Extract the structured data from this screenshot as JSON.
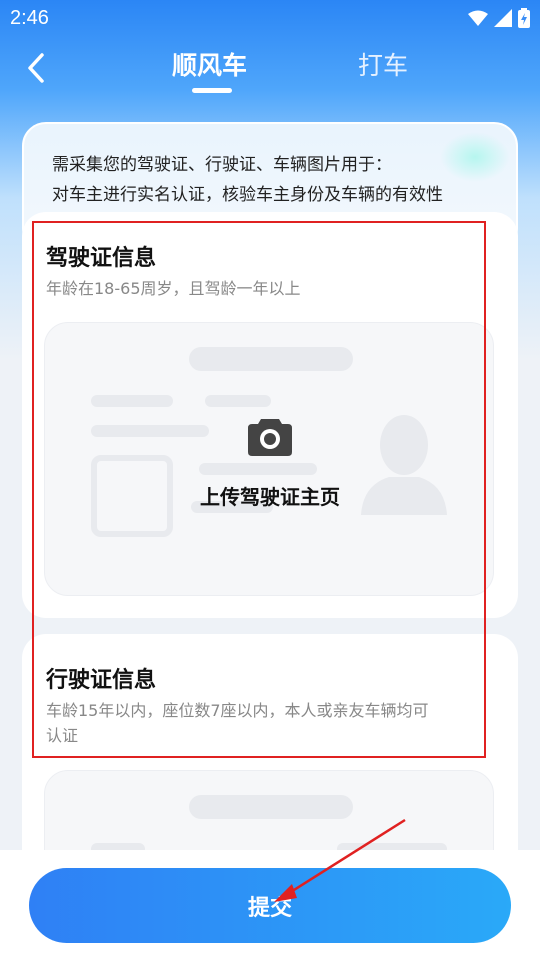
{
  "status_bar": {
    "time": "2:46"
  },
  "nav": {
    "tabs": [
      {
        "label": "顺风车",
        "active": true
      },
      {
        "label": "打车",
        "active": false
      }
    ]
  },
  "notice": {
    "line1": "需采集您的驾驶证、行驶证、车辆图片用于：",
    "line2": "对车主进行实名认证，核验车主身份及车辆的有效性"
  },
  "driver_license": {
    "title": "驾驶证信息",
    "subtitle": "年龄在18-65周岁，且驾龄一年以上",
    "upload_label": "上传驾驶证主页"
  },
  "vehicle_license": {
    "title": "行驶证信息",
    "subtitle_line1": "车龄15年以内，座位数7座以内，本人或亲友车辆均可",
    "subtitle_line2": "认证"
  },
  "submit_label": "提交",
  "colors": {
    "primary_blue": "#2f80f5",
    "highlight_red": "#e02121"
  }
}
